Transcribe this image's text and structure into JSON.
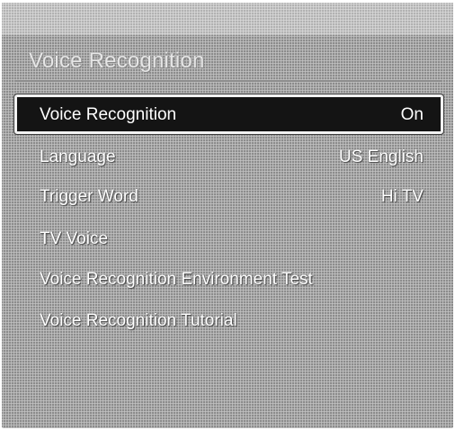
{
  "title": "Voice Recognition",
  "menu": {
    "items": [
      {
        "label": "Voice Recognition",
        "value": "On"
      },
      {
        "label": "Language",
        "value": "US English"
      },
      {
        "label": "Trigger Word",
        "value": "Hi TV"
      },
      {
        "label": "TV Voice",
        "value": ""
      },
      {
        "label": "Voice Recognition Environment Test",
        "value": ""
      },
      {
        "label": "Voice Recognition Tutorial",
        "value": ""
      }
    ]
  }
}
